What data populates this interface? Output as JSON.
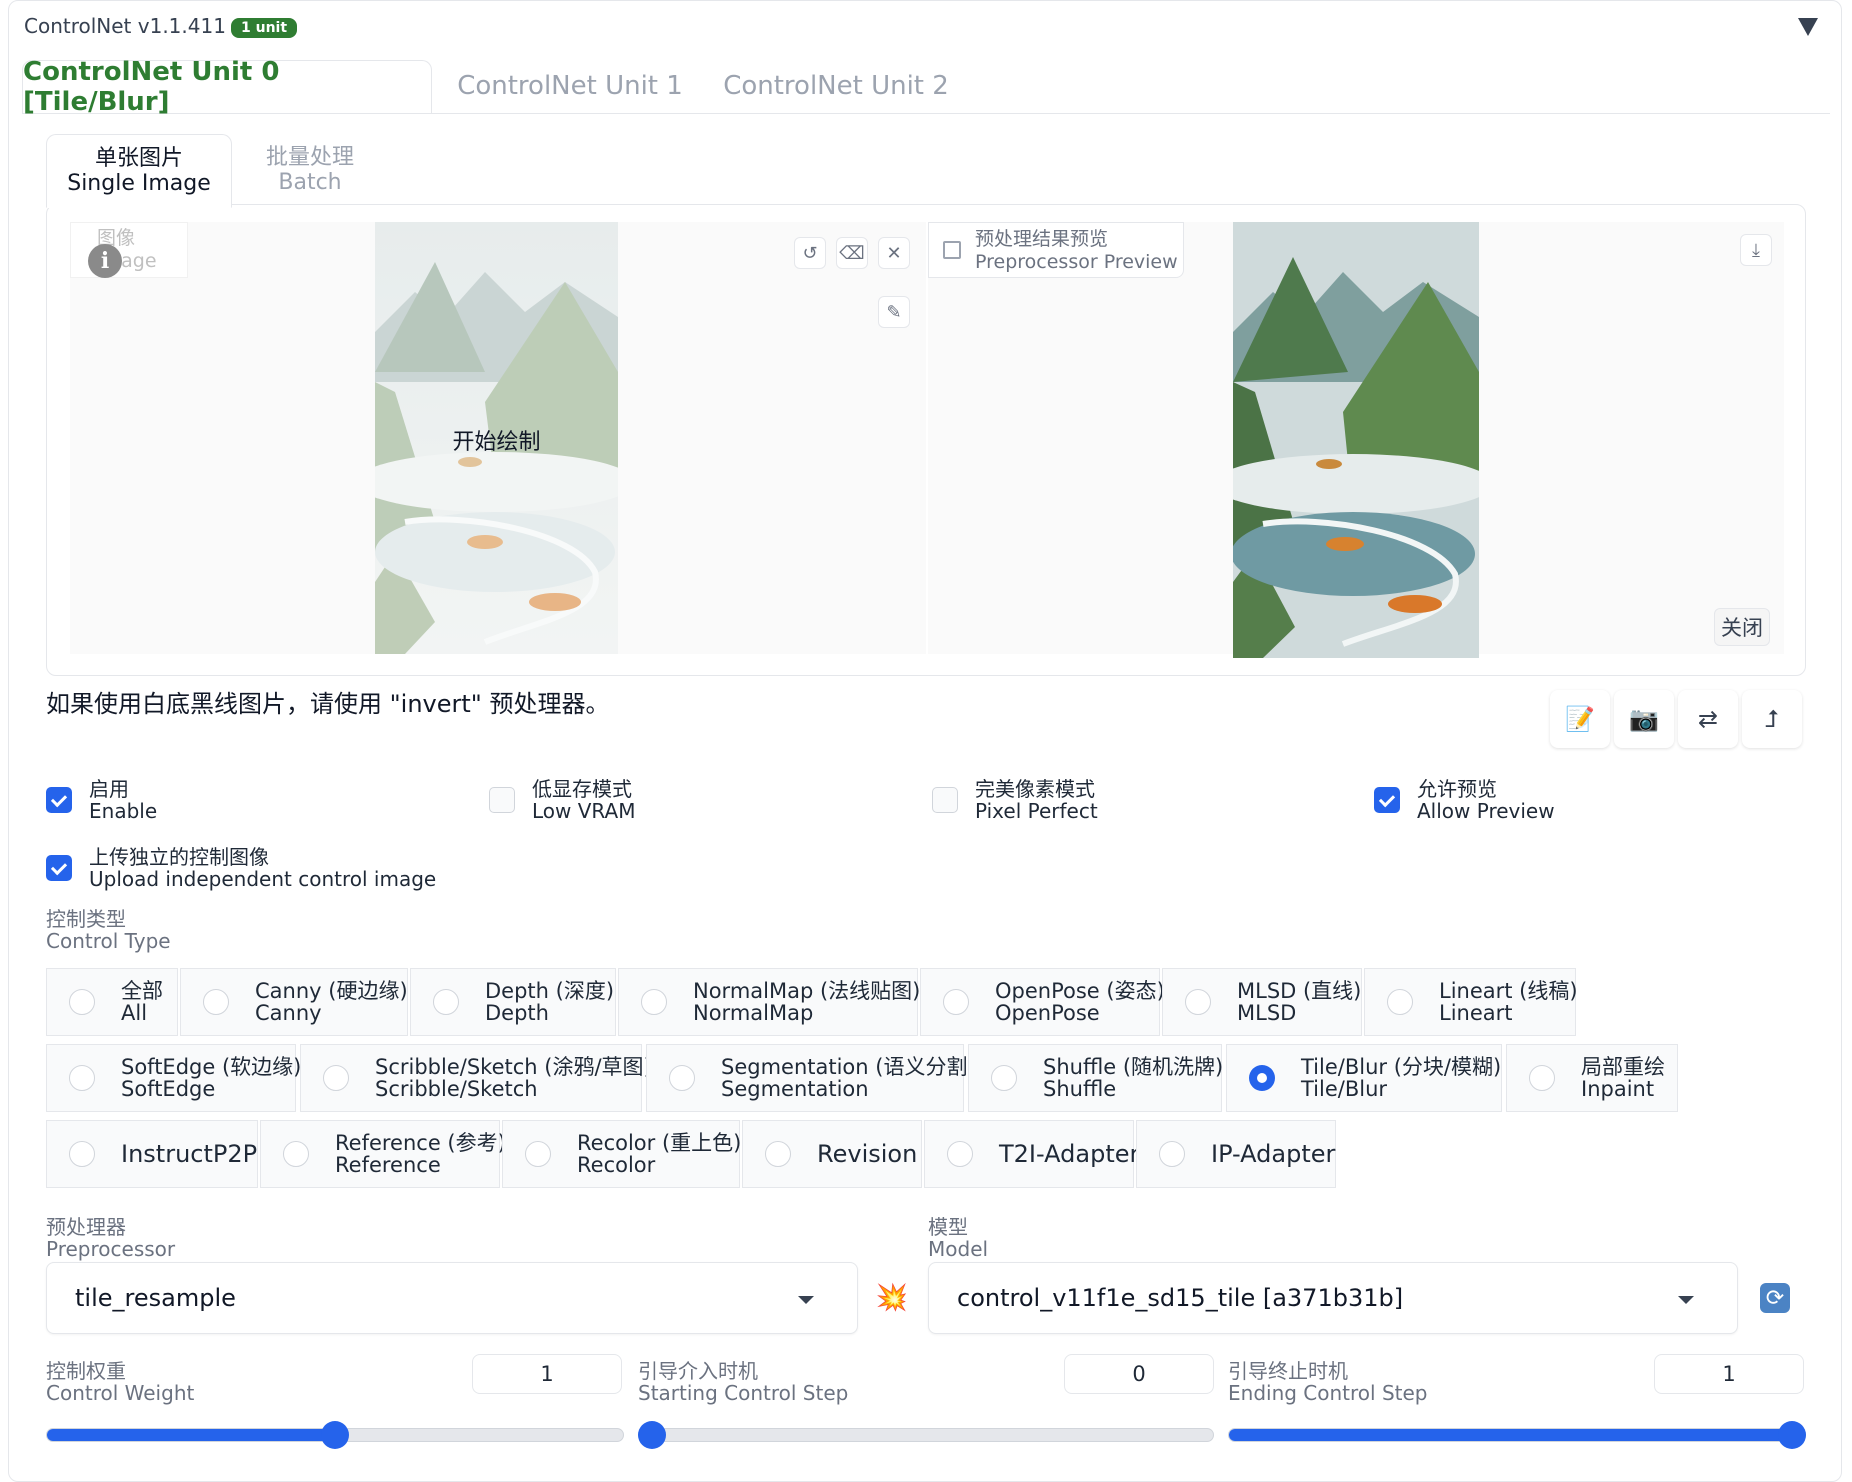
{
  "header": {
    "title": "ControlNet v1.1.411",
    "badge": "1 unit"
  },
  "unit_tabs": [
    "ControlNet Unit 0 [Tile/Blur]",
    "ControlNet Unit 1",
    "ControlNet Unit 2"
  ],
  "sub_tabs": [
    {
      "zh": "单张图片",
      "en": "Single Image"
    },
    {
      "zh": "批量处理",
      "en": "Batch"
    }
  ],
  "image_panel": {
    "label_zh": "图像",
    "label_en": "Image",
    "overlay_text": "开始绘制"
  },
  "preview_panel": {
    "label_zh": "预处理结果预览",
    "label_en": "Preprocessor Preview",
    "close": "关闭"
  },
  "hint": "如果使用白底黑线图片，请使用 \"invert\" 预处理器。",
  "checkboxes": [
    {
      "zh": "启用",
      "en": "Enable",
      "checked": true
    },
    {
      "zh": "低显存模式",
      "en": "Low VRAM",
      "checked": false
    },
    {
      "zh": "完美像素模式",
      "en": "Pixel Perfect",
      "checked": false
    },
    {
      "zh": "允许预览",
      "en": "Allow Preview",
      "checked": true
    },
    {
      "zh": "上传独立的控制图像",
      "en": "Upload independent control image",
      "checked": true
    }
  ],
  "control_type": {
    "label_zh": "控制类型",
    "label_en": "Control Type",
    "options": [
      {
        "a": "全部",
        "b": "All"
      },
      {
        "a": "Canny (硬边缘)",
        "b": "Canny"
      },
      {
        "a": "Depth (深度)",
        "b": "Depth"
      },
      {
        "a": "NormalMap (法线贴图)",
        "b": "NormalMap"
      },
      {
        "a": "OpenPose (姿态)",
        "b": "OpenPose"
      },
      {
        "a": "MLSD (直线)",
        "b": "MLSD"
      },
      {
        "a": "Lineart (线稿)",
        "b": "Lineart"
      },
      {
        "a": "SoftEdge (软边缘)",
        "b": "SoftEdge"
      },
      {
        "a": "Scribble/Sketch (涂鸦/草图)",
        "b": "Scribble/Sketch"
      },
      {
        "a": "Segmentation (语义分割)",
        "b": "Segmentation"
      },
      {
        "a": "Shuffle (随机洗牌)",
        "b": "Shuffle"
      },
      {
        "a": "Tile/Blur (分块/模糊)",
        "b": "Tile/Blur"
      },
      {
        "a": "局部重绘",
        "b": "Inpaint"
      },
      {
        "a": "InstructP2P"
      },
      {
        "a": "Reference (参考)",
        "b": "Reference"
      },
      {
        "a": "Recolor (重上色)",
        "b": "Recolor"
      },
      {
        "a": "Revision"
      },
      {
        "a": "T2I-Adapter"
      },
      {
        "a": "IP-Adapter"
      }
    ],
    "selected": "Tile/Blur"
  },
  "preprocessor": {
    "label_zh": "预处理器",
    "label_en": "Preprocessor",
    "value": "tile_resample"
  },
  "model": {
    "label_zh": "模型",
    "label_en": "Model",
    "value": "control_v11f1e_sd15_tile [a371b31b]"
  },
  "sliders": [
    {
      "zh": "控制权重",
      "en": "Control Weight",
      "value": "1",
      "fraction": 0.5
    },
    {
      "zh": "引导介入时机",
      "en": "Starting Control Step",
      "value": "0",
      "fraction": 0.0
    },
    {
      "zh": "引导终止时机",
      "en": "Ending Control Step",
      "value": "1",
      "fraction": 1.0
    }
  ],
  "icons": {
    "undo": "undo-icon",
    "eraser": "eraser-icon",
    "close": "close-icon",
    "brush": "brush-icon",
    "download": "download-icon",
    "image": "image-icon",
    "info": "info-icon",
    "edit": "edit-icon",
    "camera": "camera-icon",
    "swap": "swap-icon",
    "upload": "upload-arrow-icon",
    "run": "run-preprocessor-icon",
    "refresh": "refresh-icon"
  }
}
